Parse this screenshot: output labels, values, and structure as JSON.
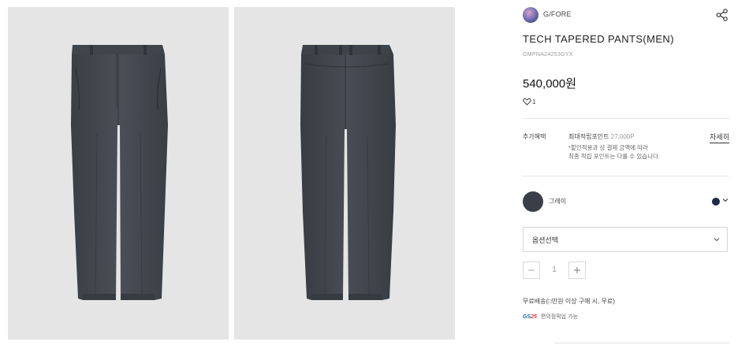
{
  "gallery": {
    "images": [
      {
        "name": "pants-front-image"
      },
      {
        "name": "pants-back-image"
      }
    ]
  },
  "product": {
    "brand": "G/FORE",
    "title": "TECH TAPERED PANTS(MEN)",
    "code": "GMPNA24253GYX",
    "price": "540,000원",
    "likes": "1"
  },
  "benefit": {
    "label": "추가혜택",
    "points_label": "최대적립포인트",
    "points_value": "27,000P",
    "note_line1": "*할인적용과 상 결제 금액에 따라",
    "note_line2": "최종 적립 포인트는 다를 수 있습니다.",
    "detail_link": "자세히"
  },
  "color": {
    "name": "그레이",
    "swatch": "#3a3e47",
    "selected_dot": "#1f2a4a"
  },
  "option": {
    "placeholder": "옵션선택"
  },
  "quantity": {
    "value": "1"
  },
  "delivery": {
    "shipping_text": "무료배송(□만원 이상 구매 시, 무료)",
    "pickup_logo_gs": "GS",
    "pickup_logo_25": "25",
    "pickup_text": "편의점픽업 가능"
  }
}
